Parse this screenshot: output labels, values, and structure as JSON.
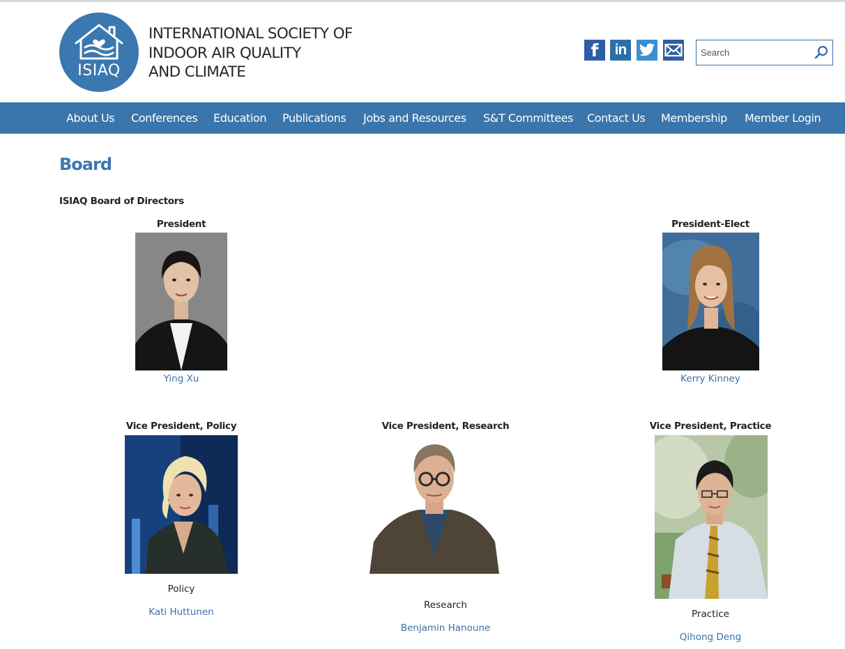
{
  "site": {
    "logo_abbr": "ISIAQ",
    "org_name_lines": [
      "INTERNATIONAL SOCIETY OF",
      "INDOOR AIR QUALITY",
      "AND CLIMATE"
    ]
  },
  "social": {
    "facebook": "f",
    "linkedin": "in"
  },
  "search": {
    "placeholder": "Search",
    "value": ""
  },
  "nav": [
    {
      "label": "About Us"
    },
    {
      "label": "Conferences"
    },
    {
      "label": "Education"
    },
    {
      "label": "Publications"
    },
    {
      "label": "Jobs and Resources"
    },
    {
      "label": "S&T Committees"
    },
    {
      "label": "Contact Us"
    },
    {
      "label": "Membership"
    },
    {
      "label": "Member Login"
    }
  ],
  "page": {
    "title": "Board",
    "section_title": "ISIAQ Board of Directors"
  },
  "board": [
    {
      "role": "President",
      "name": "Ying Xu",
      "subrole": ""
    },
    {
      "role": "President-Elect",
      "name": "Kerry Kinney",
      "subrole": ""
    },
    {
      "role": "Vice President, Policy",
      "name": "Kati Huttunen",
      "subrole": "Policy"
    },
    {
      "role": "Vice President, Research",
      "name": "Benjamin Hanoune",
      "subrole": "Research"
    },
    {
      "role": "Vice President, Practice",
      "name": "Qihong Deng",
      "subrole": "Practice"
    }
  ],
  "colors": {
    "brand_blue": "#3b78b0",
    "nav_bg": "#3a75ab",
    "link": "#3a70a8"
  }
}
